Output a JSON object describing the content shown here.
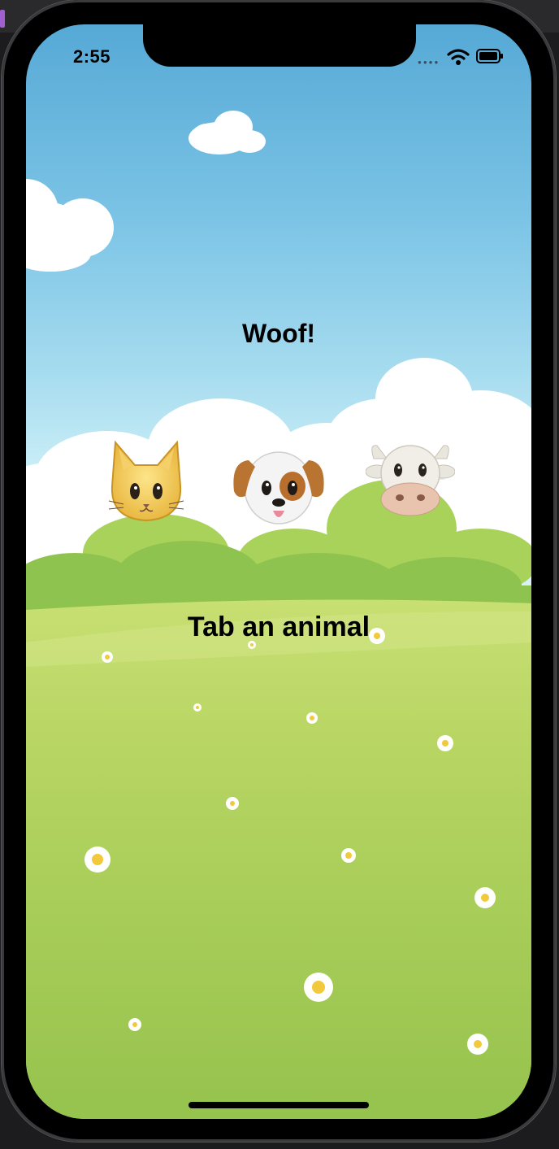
{
  "status_bar": {
    "time": "2:55"
  },
  "sound_label": "Woof!",
  "prompt": "Tab an animal",
  "animals": [
    {
      "name": "cat"
    },
    {
      "name": "dog"
    },
    {
      "name": "cow"
    }
  ],
  "colors": {
    "sky_top": "#56a9d6",
    "sky_bottom": "#d6f2f8",
    "grass_light": "#c4de6e",
    "grass_dark": "#8ebf46",
    "bush": "#8fc34f"
  }
}
